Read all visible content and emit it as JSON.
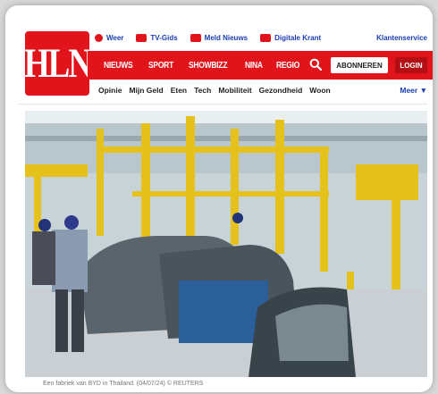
{
  "logo": {
    "text": "HLN"
  },
  "topbar": {
    "links": [
      {
        "label": "Weer",
        "icon": "weather-icon"
      },
      {
        "label": "TV-Gids",
        "icon": "tv-icon"
      },
      {
        "label": "Meld Nieuws",
        "icon": "report-icon"
      },
      {
        "label": "Digitale Krant",
        "icon": "newspaper-icon"
      }
    ],
    "klantenservice": "Klantenservice"
  },
  "nav": {
    "items": [
      "NIEUWS",
      "SPORT",
      "SHOWBIZZ",
      "NINA",
      "REGIO"
    ],
    "abonneren": "ABONNEREN",
    "login": "LOGIN"
  },
  "subnav": {
    "items": [
      "Opinie",
      "Mijn Geld",
      "Eten",
      "Tech",
      "Mobiliteit",
      "Gezondheid",
      "Woon"
    ],
    "meer": "Meer ▼"
  },
  "article": {
    "caption": "Een fabriek van BYD in Thailand. (04/07/24) © REUTERS"
  },
  "colors": {
    "brand": "#e2141b",
    "link": "#1a3db3"
  }
}
